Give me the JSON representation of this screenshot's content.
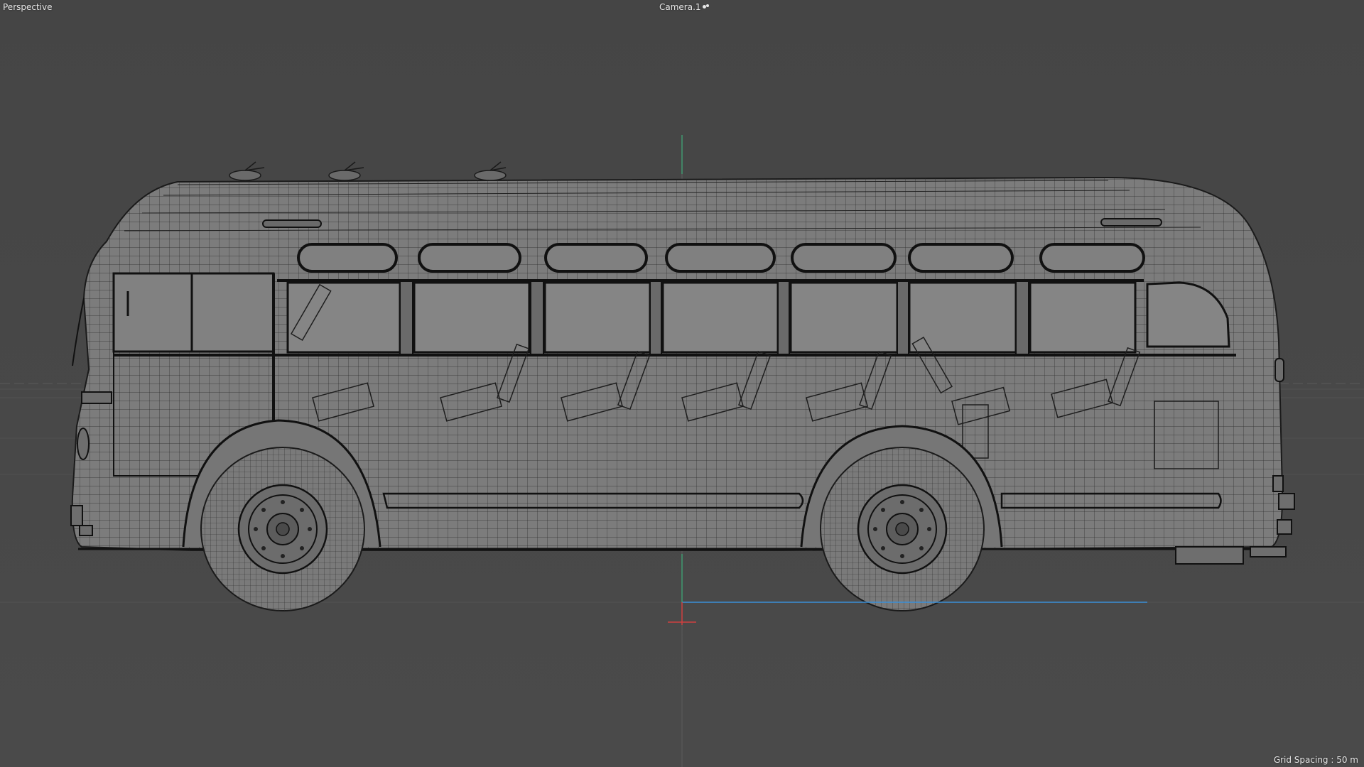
{
  "viewport": {
    "view_name": "Perspective",
    "camera_name": "Camera.1",
    "camera_icon": "camera-icon",
    "grid_spacing": "Grid Spacing : 50 m"
  },
  "colors": {
    "background": "#484848",
    "wire": "#1c1c1c",
    "body_fill": "#7d7d7d",
    "y_axis": "#3fae7a",
    "x_axis": "#3a8fd8",
    "z_axis": "#d04040"
  }
}
